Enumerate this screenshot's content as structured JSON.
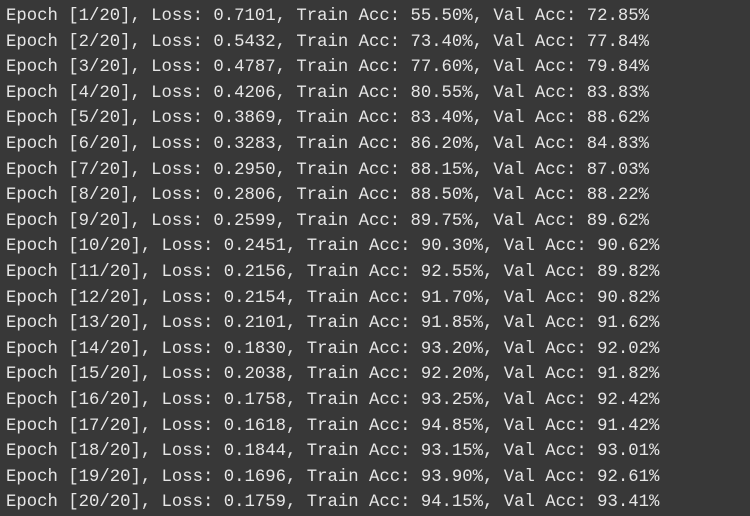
{
  "console": {
    "lines": [
      "Epoch [1/20], Loss: 0.7101, Train Acc: 55.50%, Val Acc: 72.85%",
      "Epoch [2/20], Loss: 0.5432, Train Acc: 73.40%, Val Acc: 77.84%",
      "Epoch [3/20], Loss: 0.4787, Train Acc: 77.60%, Val Acc: 79.84%",
      "Epoch [4/20], Loss: 0.4206, Train Acc: 80.55%, Val Acc: 83.83%",
      "Epoch [5/20], Loss: 0.3869, Train Acc: 83.40%, Val Acc: 88.62%",
      "Epoch [6/20], Loss: 0.3283, Train Acc: 86.20%, Val Acc: 84.83%",
      "Epoch [7/20], Loss: 0.2950, Train Acc: 88.15%, Val Acc: 87.03%",
      "Epoch [8/20], Loss: 0.2806, Train Acc: 88.50%, Val Acc: 88.22%",
      "Epoch [9/20], Loss: 0.2599, Train Acc: 89.75%, Val Acc: 89.62%",
      "Epoch [10/20], Loss: 0.2451, Train Acc: 90.30%, Val Acc: 90.62%",
      "Epoch [11/20], Loss: 0.2156, Train Acc: 92.55%, Val Acc: 89.82%",
      "Epoch [12/20], Loss: 0.2154, Train Acc: 91.70%, Val Acc: 90.82%",
      "Epoch [13/20], Loss: 0.2101, Train Acc: 91.85%, Val Acc: 91.62%",
      "Epoch [14/20], Loss: 0.1830, Train Acc: 93.20%, Val Acc: 92.02%",
      "Epoch [15/20], Loss: 0.2038, Train Acc: 92.20%, Val Acc: 91.82%",
      "Epoch [16/20], Loss: 0.1758, Train Acc: 93.25%, Val Acc: 92.42%",
      "Epoch [17/20], Loss: 0.1618, Train Acc: 94.85%, Val Acc: 91.42%",
      "Epoch [18/20], Loss: 0.1844, Train Acc: 93.15%, Val Acc: 93.01%",
      "Epoch [19/20], Loss: 0.1696, Train Acc: 93.90%, Val Acc: 92.61%",
      "Epoch [20/20], Loss: 0.1759, Train Acc: 94.15%, Val Acc: 93.41%"
    ]
  }
}
